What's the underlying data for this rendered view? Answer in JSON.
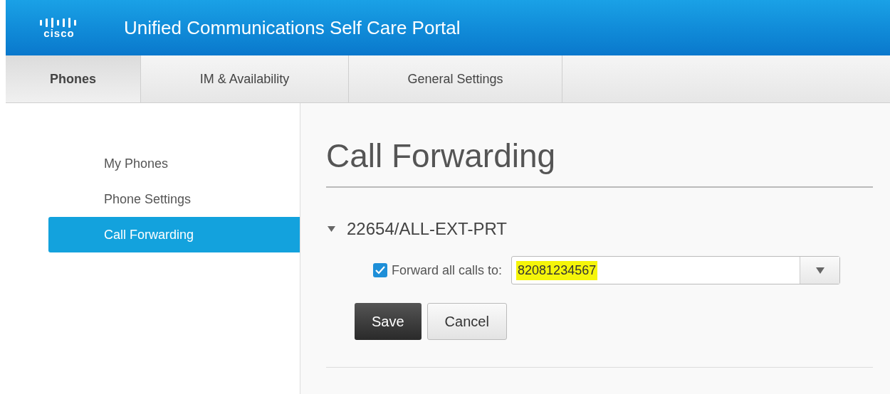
{
  "header": {
    "logo_text": "cisco",
    "title": "Unified Communications Self Care Portal"
  },
  "tabs": [
    {
      "label": "Phones",
      "selected": true
    },
    {
      "label": "IM & Availability",
      "selected": false
    },
    {
      "label": "General Settings",
      "selected": false
    }
  ],
  "sidebar": {
    "items": [
      {
        "label": "My Phones",
        "selected": false
      },
      {
        "label": "Phone Settings",
        "selected": false
      },
      {
        "label": "Call Forwarding",
        "selected": true
      }
    ]
  },
  "content": {
    "title": "Call Forwarding",
    "line": {
      "label": "22654/ALL-EXT-PRT",
      "expanded": true
    },
    "forward": {
      "checked": true,
      "label": "Forward all calls to:",
      "value": "82081234567",
      "highlighted": true
    },
    "buttons": [
      {
        "label": "Save",
        "kind": "primary"
      },
      {
        "label": "Cancel",
        "kind": "secondary"
      }
    ]
  }
}
